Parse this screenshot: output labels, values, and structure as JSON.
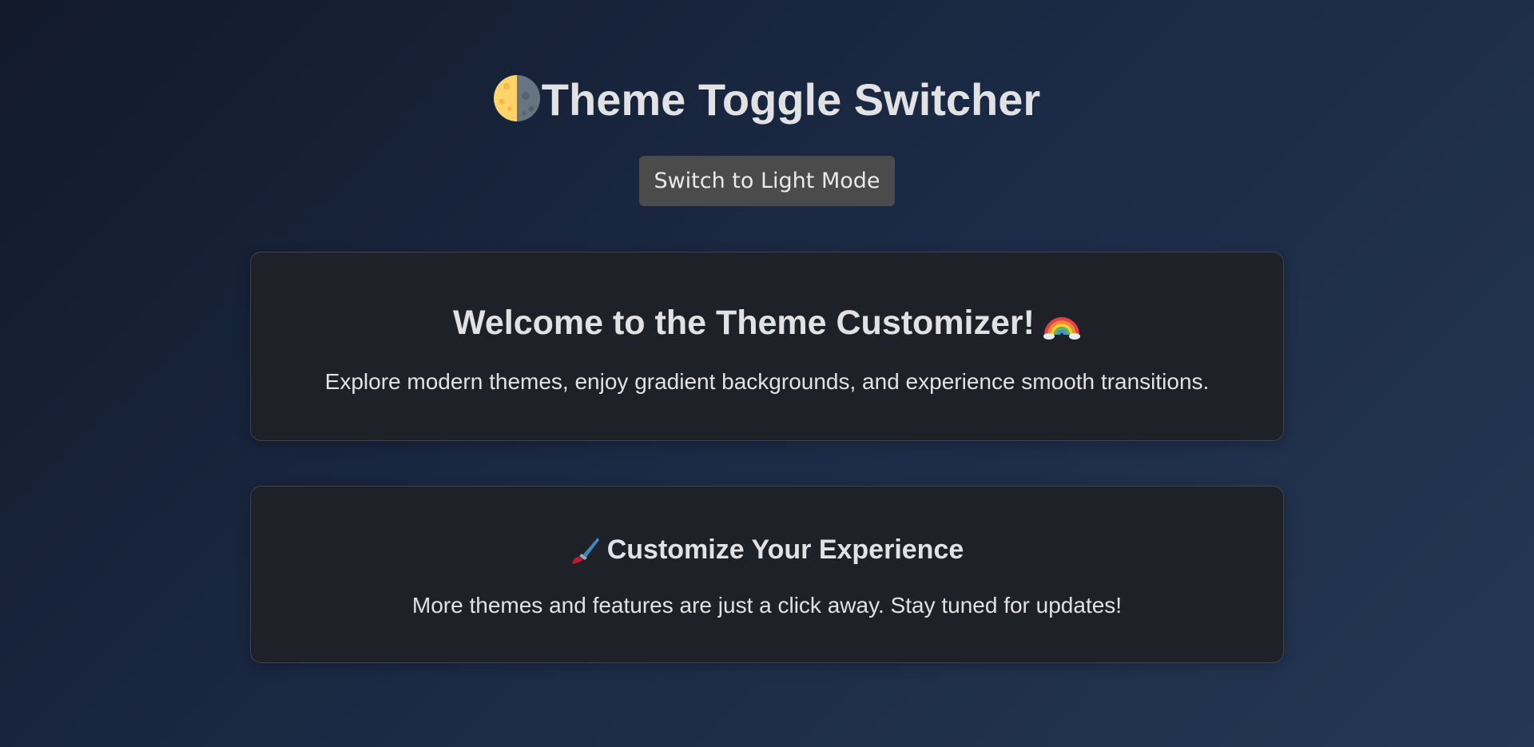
{
  "header": {
    "title": "Theme Toggle Switcher",
    "title_icon": "first-quarter-moon-icon"
  },
  "toggle": {
    "label": "Switch to Light Mode"
  },
  "welcome_card": {
    "heading": "Welcome to the Theme Customizer!",
    "heading_icon": "rainbow-icon",
    "text": "Explore modern themes, enjoy gradient backgrounds, and experience smooth transitions."
  },
  "customize_card": {
    "heading": "Customize Your Experience",
    "heading_icon": "paintbrush-icon",
    "text": "More themes and features are just a click away. Stay tuned for updates!"
  },
  "colors": {
    "background_start": "#121a2b",
    "background_end": "#243754",
    "card_background": "#1f2128",
    "button_background": "#4b4b4b",
    "text": "#e2e2e4"
  }
}
